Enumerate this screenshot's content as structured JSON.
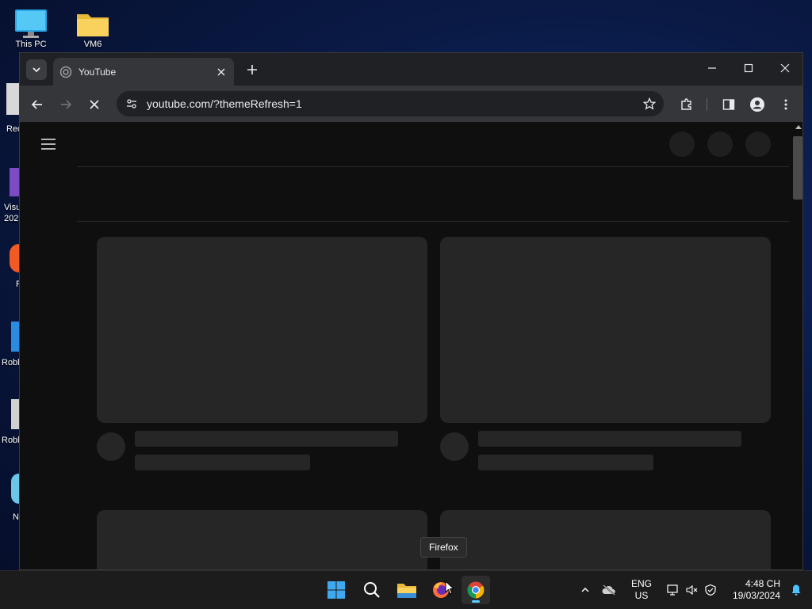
{
  "desktop": {
    "icons": [
      {
        "label": "This PC",
        "icon": "monitor-icon"
      },
      {
        "label": "VM6",
        "icon": "folder-icon"
      }
    ],
    "clipped_labels": [
      "Rec",
      "Visu",
      "202",
      "F",
      "Robl",
      "Robl",
      "N"
    ]
  },
  "browser": {
    "tab": {
      "title": "YouTube",
      "favicon": "loading-favicon-icon"
    },
    "url": "youtube.com/?themeRefresh=1"
  },
  "tooltip": {
    "text": "Firefox"
  },
  "taskbar": {
    "lang_line1": "ENG",
    "lang_line2": "US",
    "time": "4:48 CH",
    "date": "19/03/2024"
  },
  "colors": {
    "skeleton": "#262626",
    "page_bg": "#0f0f0f",
    "accent": "#60cdff"
  }
}
